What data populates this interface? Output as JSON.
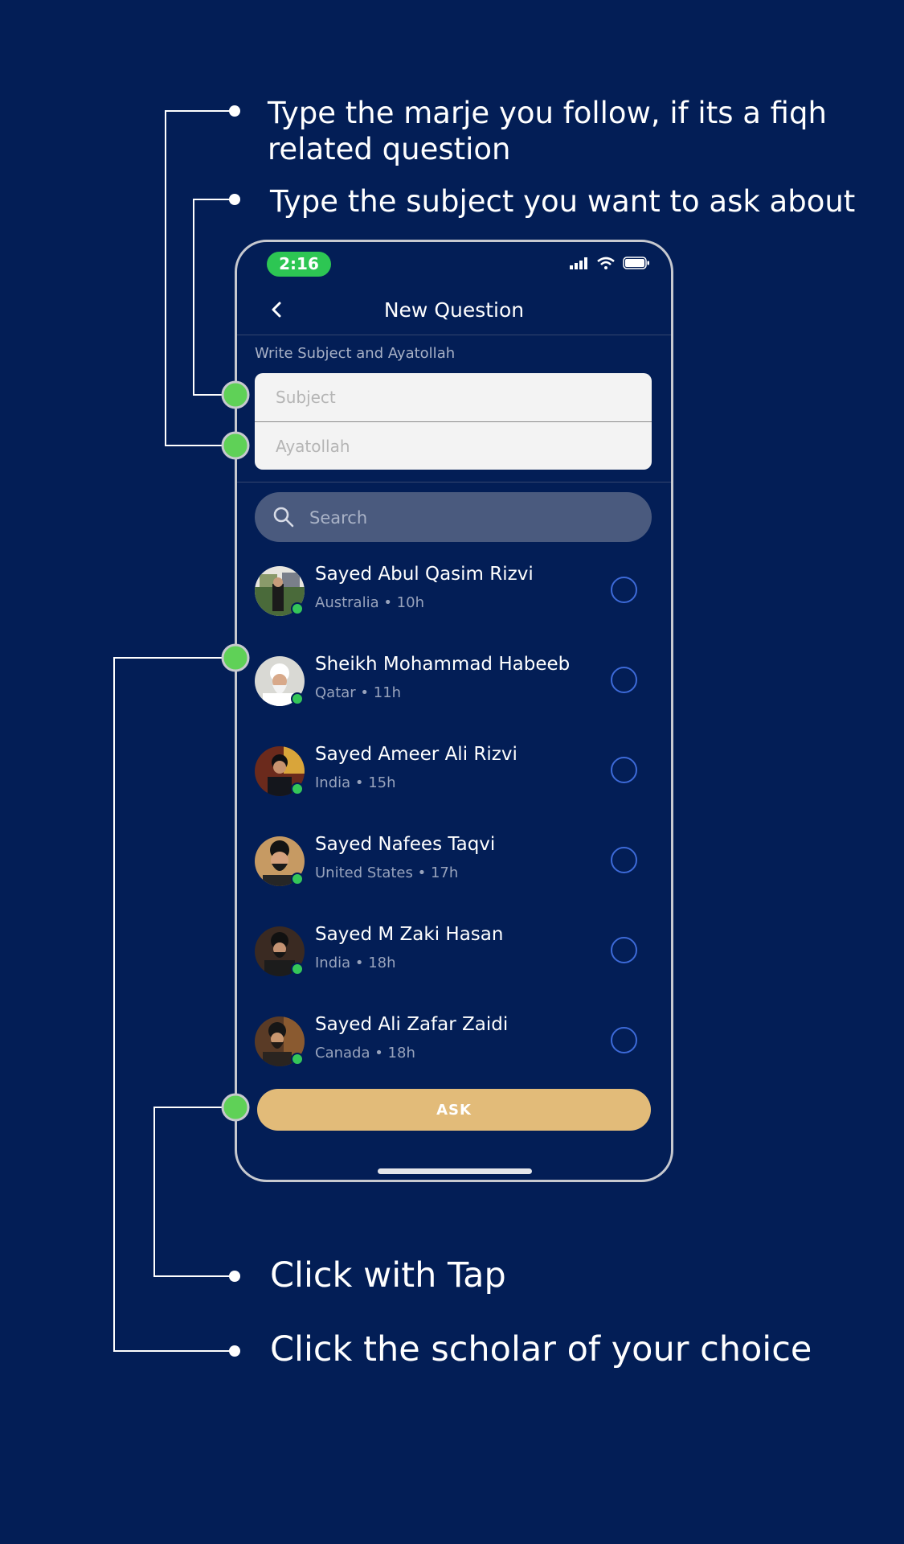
{
  "callouts": {
    "marje": "Type the marje you follow, if its a fiqh related question",
    "subject": "Type the subject you want to ask about",
    "tap": "Click with Tap",
    "scholar": "Click the scholar of your choice"
  },
  "status_bar": {
    "time": "2:16"
  },
  "nav": {
    "title": "New Question"
  },
  "form": {
    "label": "Write Subject and Ayatollah",
    "subject_placeholder": "Subject",
    "ayatollah_placeholder": "Ayatollah"
  },
  "search": {
    "placeholder": "Search"
  },
  "scholars": [
    {
      "name": "Sayed Abul Qasim Rizvi",
      "meta": "Australia • 10h"
    },
    {
      "name": "Sheikh Mohammad Habeeb",
      "meta": "Qatar • 11h"
    },
    {
      "name": "Sayed Ameer Ali Rizvi",
      "meta": "India • 15h"
    },
    {
      "name": "Sayed Nafees Taqvi",
      "meta": "United States • 17h"
    },
    {
      "name": "Sayed M Zaki Hasan",
      "meta": "India • 18h"
    },
    {
      "name": "Sayed Ali Zafar Zaidi",
      "meta": "Canada • 18h"
    }
  ],
  "ask_button": {
    "label": "ASK"
  },
  "colors": {
    "background": "#031e56",
    "hotspot": "#5fd157",
    "ask_button": "#e2bb79",
    "status_time_pill": "#2dc653"
  }
}
